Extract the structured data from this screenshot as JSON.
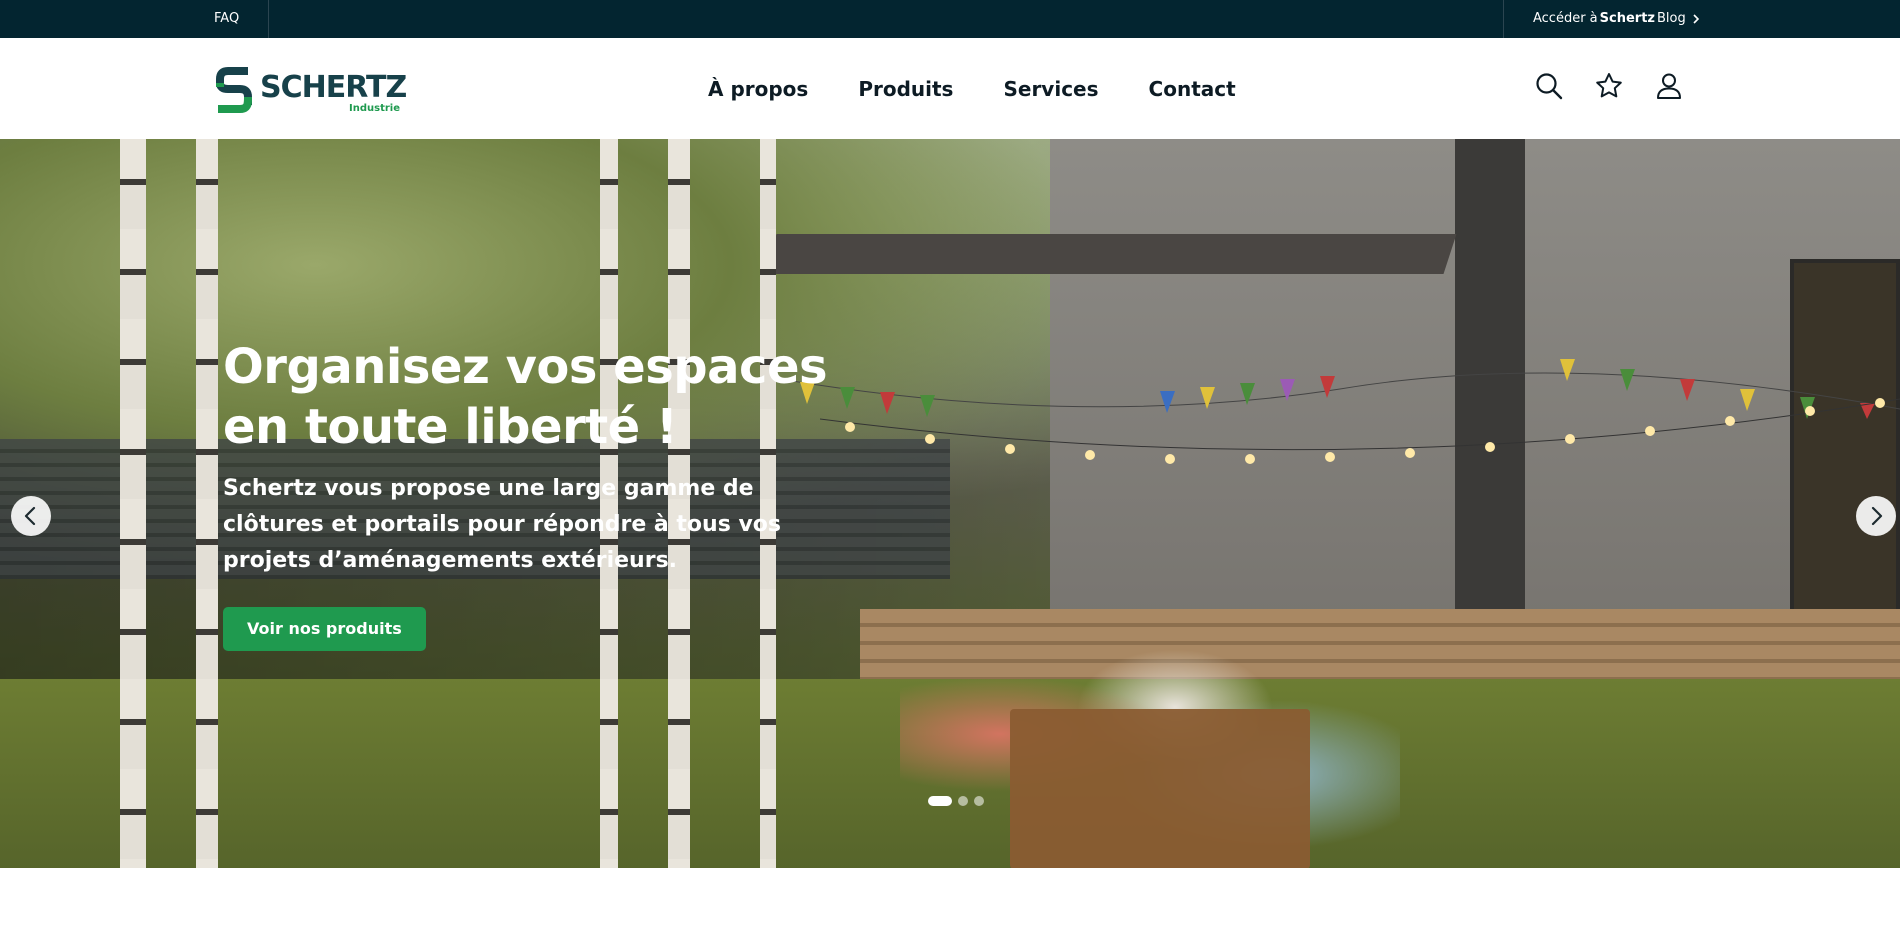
{
  "topbar": {
    "faq_label": "FAQ",
    "blog_prefix": "Accéder à ",
    "blog_brand": "Schertz",
    "blog_suffix": "Blog"
  },
  "logo": {
    "brand": "SCHERTZ",
    "sub": "Industrie"
  },
  "nav": {
    "items": [
      {
        "label": "À propos"
      },
      {
        "label": "Produits"
      },
      {
        "label": "Services"
      },
      {
        "label": "Contact"
      }
    ]
  },
  "header_icons": [
    "search-icon",
    "star-icon",
    "user-icon"
  ],
  "hero": {
    "title_line1": "Organisez vos espaces",
    "title_line2": "en toute liberté !",
    "text": "Schertz vous propose une large gamme de clôtures et portails pour répondre à tous vos projets d’aménagements extérieurs.",
    "button_label": "Voir nos produits",
    "slide_count": 3,
    "active_slide": 1
  },
  "colors": {
    "topbar_bg": "#032530",
    "brand_green": "#1f9a4f",
    "brand_dark": "#17414a",
    "text_dark": "#0d1b24"
  }
}
